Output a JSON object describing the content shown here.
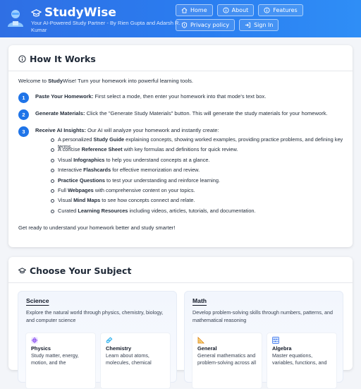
{
  "header": {
    "brand": "StudyWise",
    "tagline": "Your AI-Powered Study Partner - By Rien Gupta and Adarsh R. Kumar",
    "nav": [
      {
        "label": "Home",
        "icon": "home-icon"
      },
      {
        "label": "About",
        "icon": "info-icon"
      },
      {
        "label": "Features",
        "icon": "info-icon"
      },
      {
        "label": "Privacy policy",
        "icon": "shield-icon"
      },
      {
        "label": "Sign In",
        "icon": "sign-in-icon"
      }
    ]
  },
  "how_it_works": {
    "title": "How It Works",
    "intro_prefix": "Welcome to ",
    "intro_brand_bold": "Study",
    "intro_brand_rest": "Wise",
    "intro_suffix": "! Turn your homework into powerful learning tools.",
    "steps": [
      {
        "number": "1",
        "title": "Paste Your Homework:",
        "text": " First select a mode, then enter your homework into that mode's text box."
      },
      {
        "number": "2",
        "title": "Generate Materials:",
        "text": " Click the \"Generate Study Materials\" button. This will generate the study materials for your homework."
      },
      {
        "number": "3",
        "title": "Receive AI Insights:",
        "text": " Our AI will analyze your homework and instantly create:"
      }
    ],
    "outputs": [
      {
        "before": "A personalized ",
        "bold": "Study Guide",
        "after": " explaining concepts, showing worked examples, providing practice problems, and defining key terms."
      },
      {
        "before": "A concise ",
        "bold": "Reference Sheet",
        "after": " with key formulas and definitions for quick review."
      },
      {
        "before": "Visual ",
        "bold": "Infographics",
        "after": " to help you understand concepts at a glance."
      },
      {
        "before": "Interactive ",
        "bold": "Flashcards",
        "after": " for effective memorization and review."
      },
      {
        "before": "",
        "bold": "Practice Questions",
        "after": " to test your understanding and reinforce learning."
      },
      {
        "before": "Full ",
        "bold": "Webpages",
        "after": " with comprehensive content on your topics."
      },
      {
        "before": "Visual ",
        "bold": "Mind Maps",
        "after": " to see how concepts connect and relate."
      },
      {
        "before": "Curated ",
        "bold": "Learning Resources",
        "after": " including videos, articles, tutorials, and documentation."
      }
    ],
    "outro": "Get ready to understand your homework better and study smarter!"
  },
  "choose_subject": {
    "title": "Choose Your Subject",
    "subjects": [
      {
        "name": "Science",
        "description": "Explore the natural world through physics, chemistry, biology, and computer science",
        "topics": [
          {
            "name": "Physics",
            "icon": "atom-icon",
            "icon_color": "#7c3aed",
            "description": "Study matter, energy, motion, and the"
          },
          {
            "name": "Chemistry",
            "icon": "test-tube-icon",
            "icon_color": "#0ea5e9",
            "description": "Learn about atoms, molecules, chemical"
          }
        ]
      },
      {
        "name": "Math",
        "description": "Develop problem-solving skills through numbers, patterns, and mathematical reasoning",
        "topics": [
          {
            "name": "General",
            "icon": "triangle-ruler-icon",
            "icon_color": "#d97706",
            "description": "General mathematics and problem-solving across all"
          },
          {
            "name": "Algebra",
            "icon": "abacus-icon",
            "icon_color": "#2563eb",
            "description": "Master equations, variables, functions, and"
          }
        ]
      }
    ]
  },
  "colors": {
    "header_gradient_start": "#2f6fe4",
    "header_gradient_end": "#2f8ef6",
    "step_badge": "#1f74e8",
    "page_background": "#f3f5f9"
  }
}
